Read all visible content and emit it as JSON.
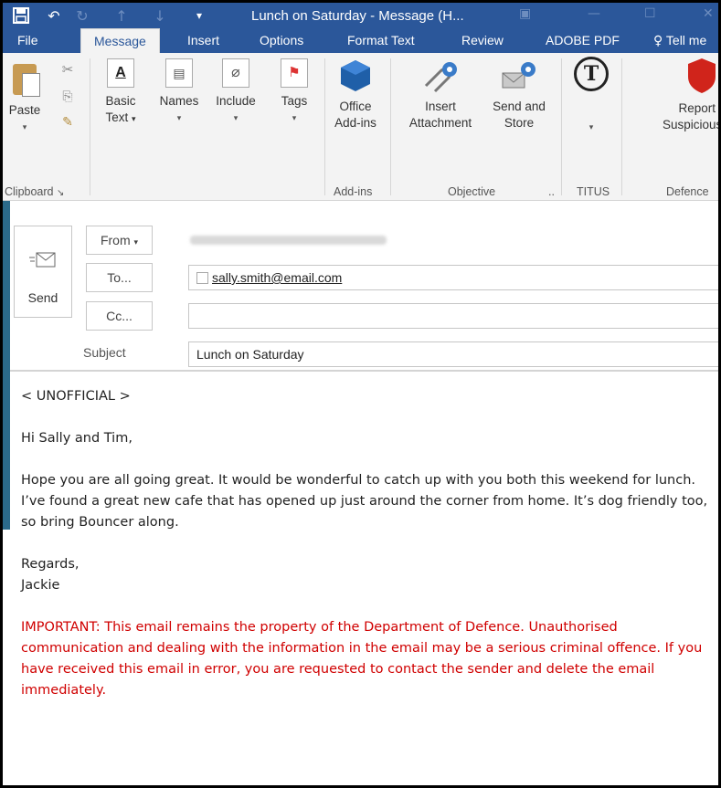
{
  "window": {
    "title": "Lunch on Saturday - Message (H...",
    "qat_icons": [
      "save-icon",
      "undo-icon",
      "redo-icon",
      "up-icon",
      "down-icon",
      "customize-icon"
    ],
    "controls": [
      "restore-icon",
      "minimize-icon",
      "maximize-icon",
      "close-icon"
    ]
  },
  "tabs": [
    {
      "label": "File"
    },
    {
      "label": "Message",
      "active": true
    },
    {
      "label": "Insert"
    },
    {
      "label": "Options"
    },
    {
      "label": "Format Text"
    },
    {
      "label": "Review"
    },
    {
      "label": "ADOBE PDF"
    },
    {
      "label": "Tell me"
    }
  ],
  "ribbon": {
    "paste": "Paste",
    "basic_text_1": "Basic",
    "basic_text_2": "Text",
    "names": "Names",
    "include": "Include",
    "tags": "Tags",
    "office_1": "Office",
    "office_2": "Add-ins",
    "insert_1": "Insert",
    "insert_2": "Attachment",
    "sendstore_1": "Send and",
    "sendstore_2": "Store",
    "report_1": "Report",
    "report_2": "Suspicious E",
    "groups": {
      "clipboard": "Clipboard",
      "addins": "Add-ins",
      "objective": "Objective",
      "titus": "TITUS",
      "defence": "Defence"
    }
  },
  "compose": {
    "send_label": "Send",
    "from_label": "From",
    "to_label": "To...",
    "cc_label": "Cc...",
    "subject_label": "Subject",
    "to_value": "sally.smith@email.com",
    "cc_value": "",
    "subject_value": "Lunch on Saturday"
  },
  "message": {
    "classification": "< UNOFFICIAL >",
    "greeting": "Hi Sally and Tim,",
    "body": "Hope you are all going great. It would be wonderful to catch up with you both this weekend for lunch. I’ve found a great new cafe that has opened up just around the corner from home. It’s dog friendly too, so bring Bouncer along.",
    "signoff": "Regards,",
    "name": "Jackie",
    "disclaimer": "IMPORTANT: This email remains the property of the Department of Defence. Unauthorised communication and dealing with the information in the email may be a serious criminal offence. If you have received this email in error, you are requested to contact the sender and delete the email immediately."
  },
  "colors": {
    "titlebar": "#2b579a",
    "ribbon": "#f3f3f3",
    "disclaimer": "#d00000"
  }
}
